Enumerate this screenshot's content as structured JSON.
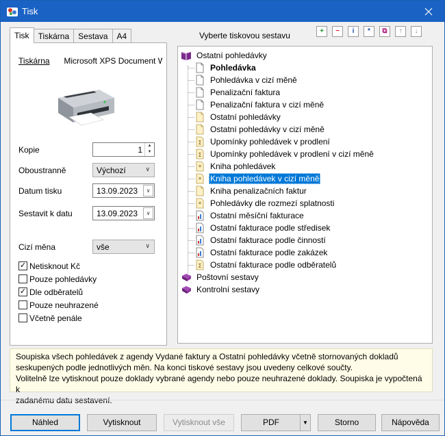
{
  "window": {
    "title": "Tisk"
  },
  "tabs": [
    "Tisk",
    "Tiskárna",
    "Sestava",
    "A4"
  ],
  "left": {
    "printer_label": "Tiskárna",
    "printer_name": "Microsoft XPS Document W",
    "copies_label": "Kopie",
    "copies_value": "1",
    "duplex_label": "Oboustranně",
    "duplex_value": "Výchozí",
    "print_date_label": "Datum tisku",
    "print_date_value": "13.09.2023",
    "compile_date_label": "Sestavit k datu",
    "compile_date_value": "13.09.2023",
    "currency_label": "Cizí měna",
    "currency_value": "vše",
    "checkboxes": [
      {
        "label": "Netisknout Kč",
        "checked": true
      },
      {
        "label": "Pouze pohledávky",
        "checked": false
      },
      {
        "label": "Dle odběratelů",
        "checked": true
      },
      {
        "label": "Pouze neuhrazené",
        "checked": false
      },
      {
        "label": "Včetně penále",
        "checked": false
      }
    ]
  },
  "right": {
    "title": "Vyberte tiskovou sestavu",
    "toolbar": [
      "add-icon",
      "remove-icon",
      "info-icon",
      "new-report-icon",
      "copy-icon",
      "move-up-icon",
      "move-down-icon"
    ],
    "tree": {
      "root": "Ostatní pohledávky",
      "items": [
        {
          "label": "Pohledávka",
          "icon": "doc",
          "bold": true
        },
        {
          "label": "Pohledávka v cizí měně",
          "icon": "doc"
        },
        {
          "label": "Penalizační faktura",
          "icon": "doc"
        },
        {
          "label": "Penalizační faktura v cizí měně",
          "icon": "doc"
        },
        {
          "label": "Ostatní pohledávky",
          "icon": "list"
        },
        {
          "label": "Ostatní pohledávky v cizí měně",
          "icon": "list"
        },
        {
          "label": "Upomínky pohledávek v prodlení",
          "icon": "sum"
        },
        {
          "label": "Upomínky pohledávek v prodlení v cizí měně",
          "icon": "sum"
        },
        {
          "label": "Kniha pohledávek",
          "icon": "star"
        },
        {
          "label": "Kniha pohledávek v cizí měně",
          "icon": "star",
          "selected": true
        },
        {
          "label": "Kniha penalizačních faktur",
          "icon": "list"
        },
        {
          "label": "Pohledávky dle rozmezí splatnosti",
          "icon": "star"
        },
        {
          "label": "Ostatní měsíční fakturace",
          "icon": "chart"
        },
        {
          "label": "Ostatní fakturace podle středisek",
          "icon": "chart"
        },
        {
          "label": "Ostatní fakturace podle činností",
          "icon": "chart"
        },
        {
          "label": "Ostatní fakturace podle zakázek",
          "icon": "chart"
        },
        {
          "label": "Ostatní fakturace podle odběratelů",
          "icon": "sum"
        }
      ],
      "groups": [
        "Poštovní sestavy",
        "Kontrolní sestavy"
      ]
    }
  },
  "description": [
    "Soupiska všech pohledávek z agendy Vydané faktury a Ostatní pohledávky včetně stornovaných dokladů",
    "seskupených podle jednotlivých měn. Na konci tiskové sestavy jsou uvedeny celkové součty.",
    "Volitelně lze vytisknout pouze doklady vybrané agendy nebo pouze neuhrazené doklady. Soupiska je vypočtená k",
    "zadanému datu sestavení."
  ],
  "buttons": {
    "preview": "Náhled",
    "print": "Vytisknout",
    "print_all": "Vytisknout vše",
    "pdf": "PDF",
    "cancel": "Storno",
    "help": "Nápověda"
  }
}
